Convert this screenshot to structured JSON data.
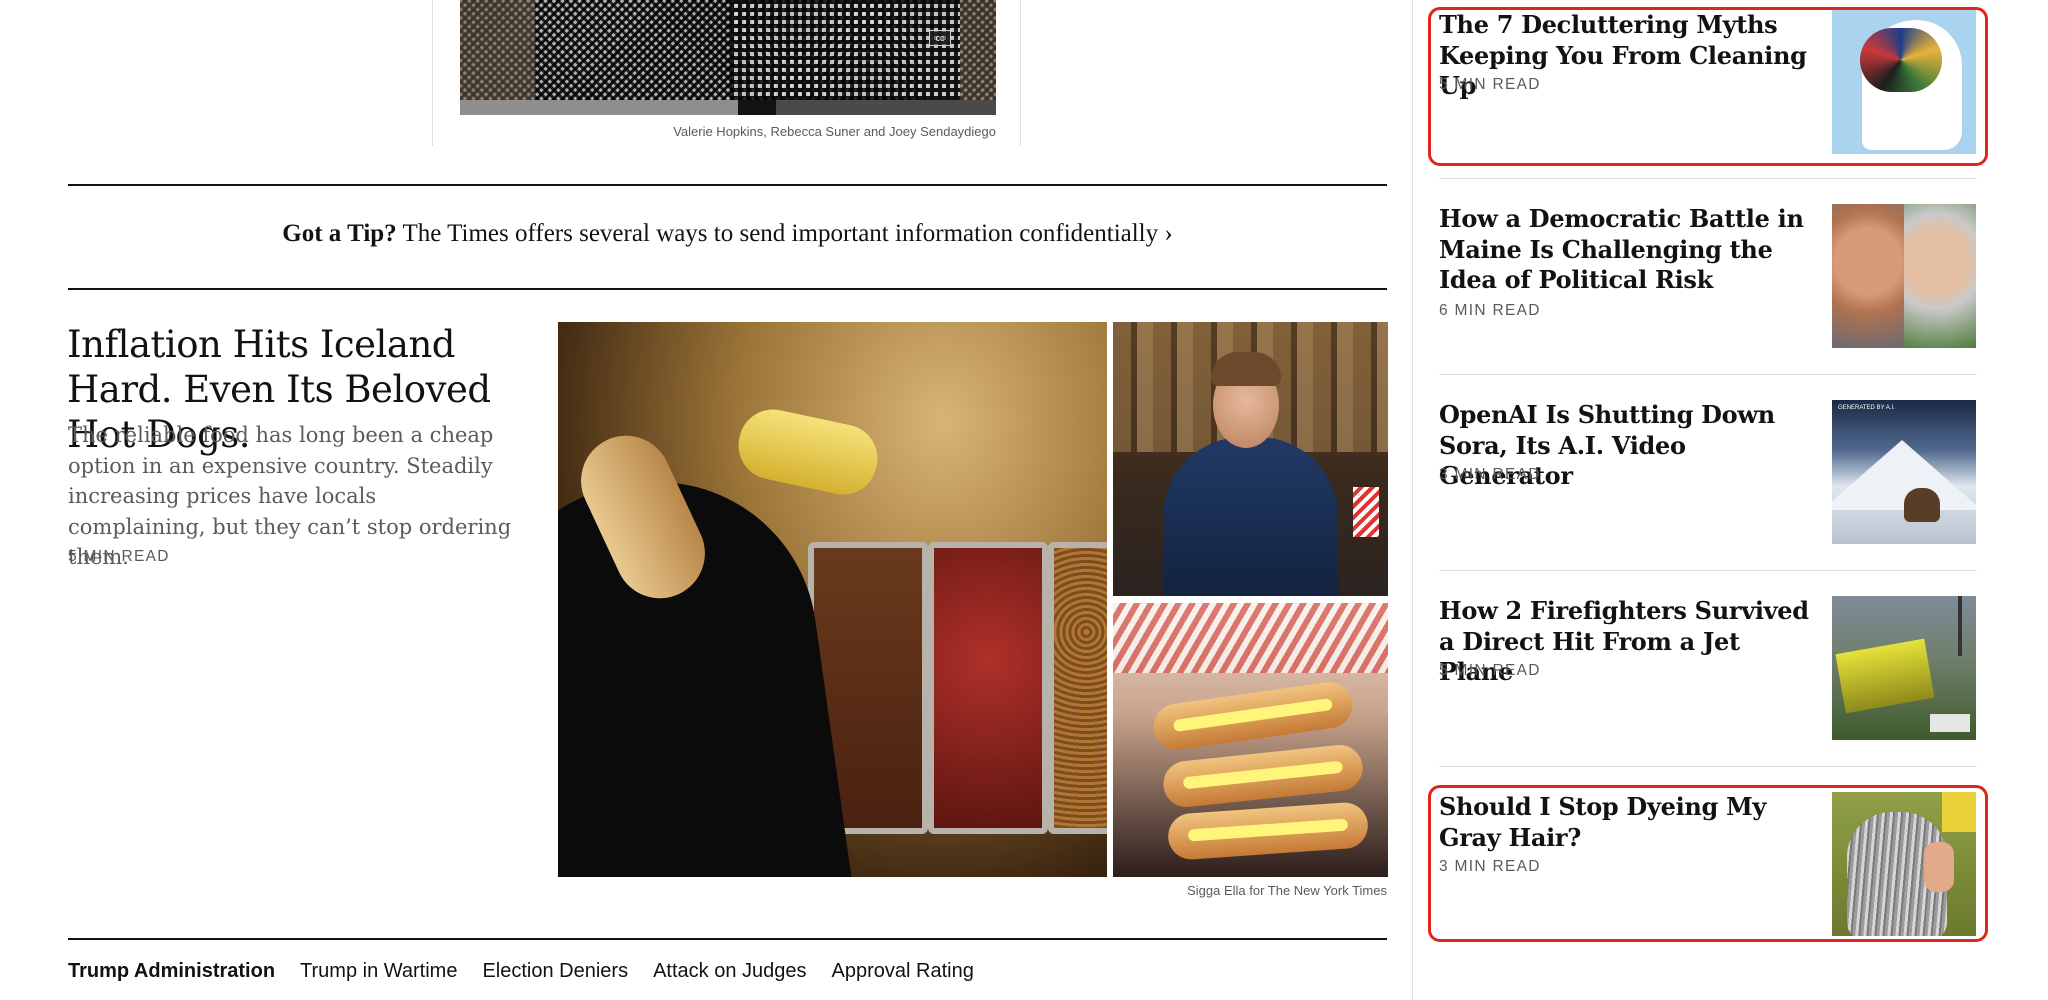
{
  "video": {
    "credit": "Valerie Hopkins, Rebecca Suner and Joey Sendaydiego",
    "cc_label": "cc"
  },
  "tip": {
    "lead": "Got a Tip?",
    "text": " The Times offers several ways to send important information confidentially ›"
  },
  "story": {
    "headline": "Inflation Hits Iceland Hard. Even Its Beloved Hot Dogs.",
    "summary": "The reliable food has long been a cheap option in an expensive country. Steadily increasing prices have locals complaining, but they can’t stop ordering them.",
    "read_time": "5 MIN READ",
    "photo_credit": "Sigga Ella for The New York Times"
  },
  "topic_nav": {
    "lead": "Trump Administration",
    "items": [
      "Trump in Wartime",
      "Election Deniers",
      "Attack on Judges",
      "Approval Rating"
    ]
  },
  "sidebar": {
    "items": [
      {
        "title": "The 7 Decluttering Myths Keeping You From Cleaning Up",
        "read_time": "5 MIN READ"
      },
      {
        "title": "How a Democratic Battle in Maine Is Challenging the Idea of Political Risk",
        "read_time": "6 MIN READ"
      },
      {
        "title": "OpenAI Is Shutting Down Sora, Its A.I. Video Generator",
        "read_time": "3 MIN READ",
        "thumb_tag": "GENERATED BY A.I."
      },
      {
        "title": "How 2 Firefighters Survived a Direct Hit From a Jet Plane",
        "read_time": "5 MIN READ"
      },
      {
        "title": "Should I Stop Dyeing My Gray Hair?",
        "read_time": "3 MIN READ"
      }
    ]
  },
  "colors": {
    "highlight": "#e0261b",
    "text": "#121212",
    "muted": "#5a5a5a",
    "rule": "#dfdfdf"
  }
}
